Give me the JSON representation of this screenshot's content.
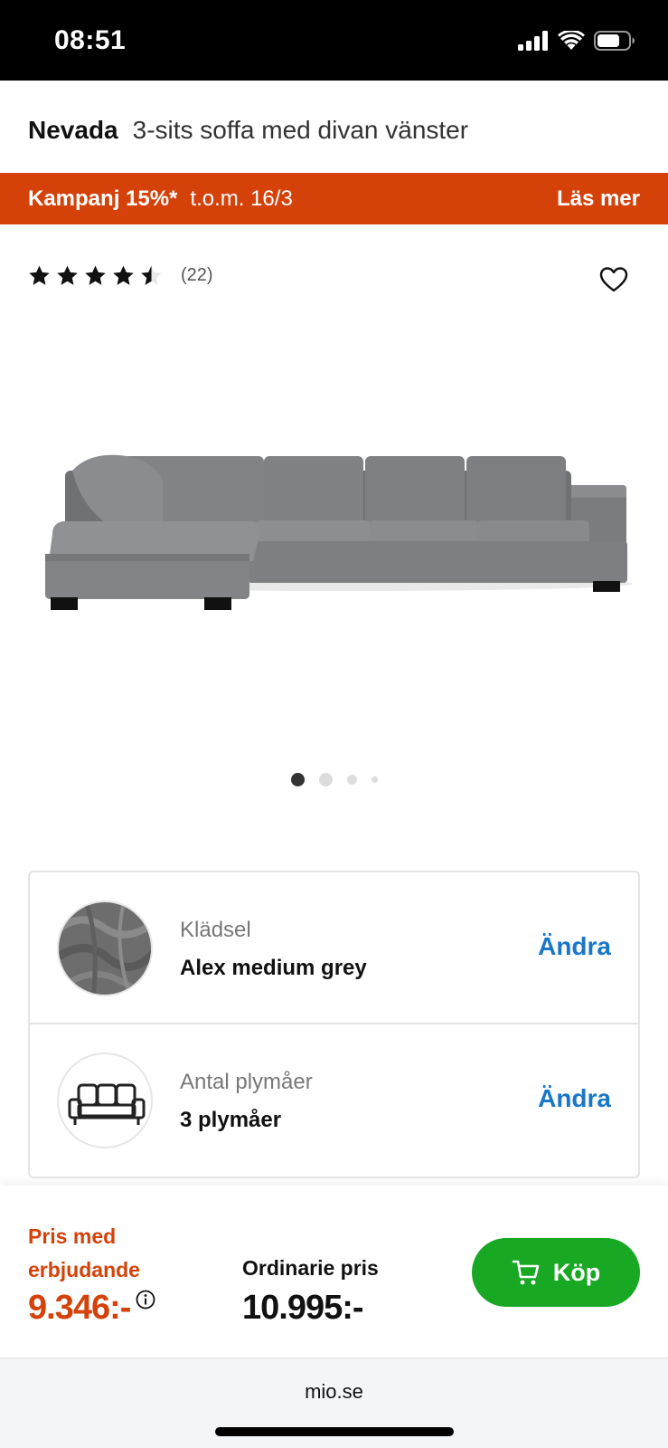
{
  "status_bar": {
    "time": "08:51",
    "icons": [
      "signal-icon",
      "wifi-icon",
      "battery-icon"
    ]
  },
  "product": {
    "name": "Nevada",
    "description": "3-sits soffa med divan vänster"
  },
  "campaign": {
    "title": "Kampanj 15%*",
    "date": "t.o.m. 16/3",
    "more_label": "Läs mer",
    "color": "#d4420a"
  },
  "rating": {
    "stars": 4.5,
    "max_stars": 5,
    "count": "(22)"
  },
  "carousel": {
    "total_images": 4,
    "active_index": 0
  },
  "options": [
    {
      "label": "Klädsel",
      "value": "Alex medium grey",
      "action": "Ändra",
      "icon": "fabric-swatch-thumb"
    },
    {
      "label": "Antal plymåer",
      "value": "3 plymåer",
      "action": "Ändra",
      "icon": "sofa-cushions-icon"
    }
  ],
  "pricing": {
    "offer_label": "Pris med erbjudande",
    "offer_price": "9.346:-",
    "regular_label": "Ordinarie pris",
    "regular_price": "10.995:-",
    "buy_label": "Köp",
    "accent_color": "#d4420a",
    "buy_color": "#18a824"
  },
  "browser": {
    "url": "mio.se"
  }
}
